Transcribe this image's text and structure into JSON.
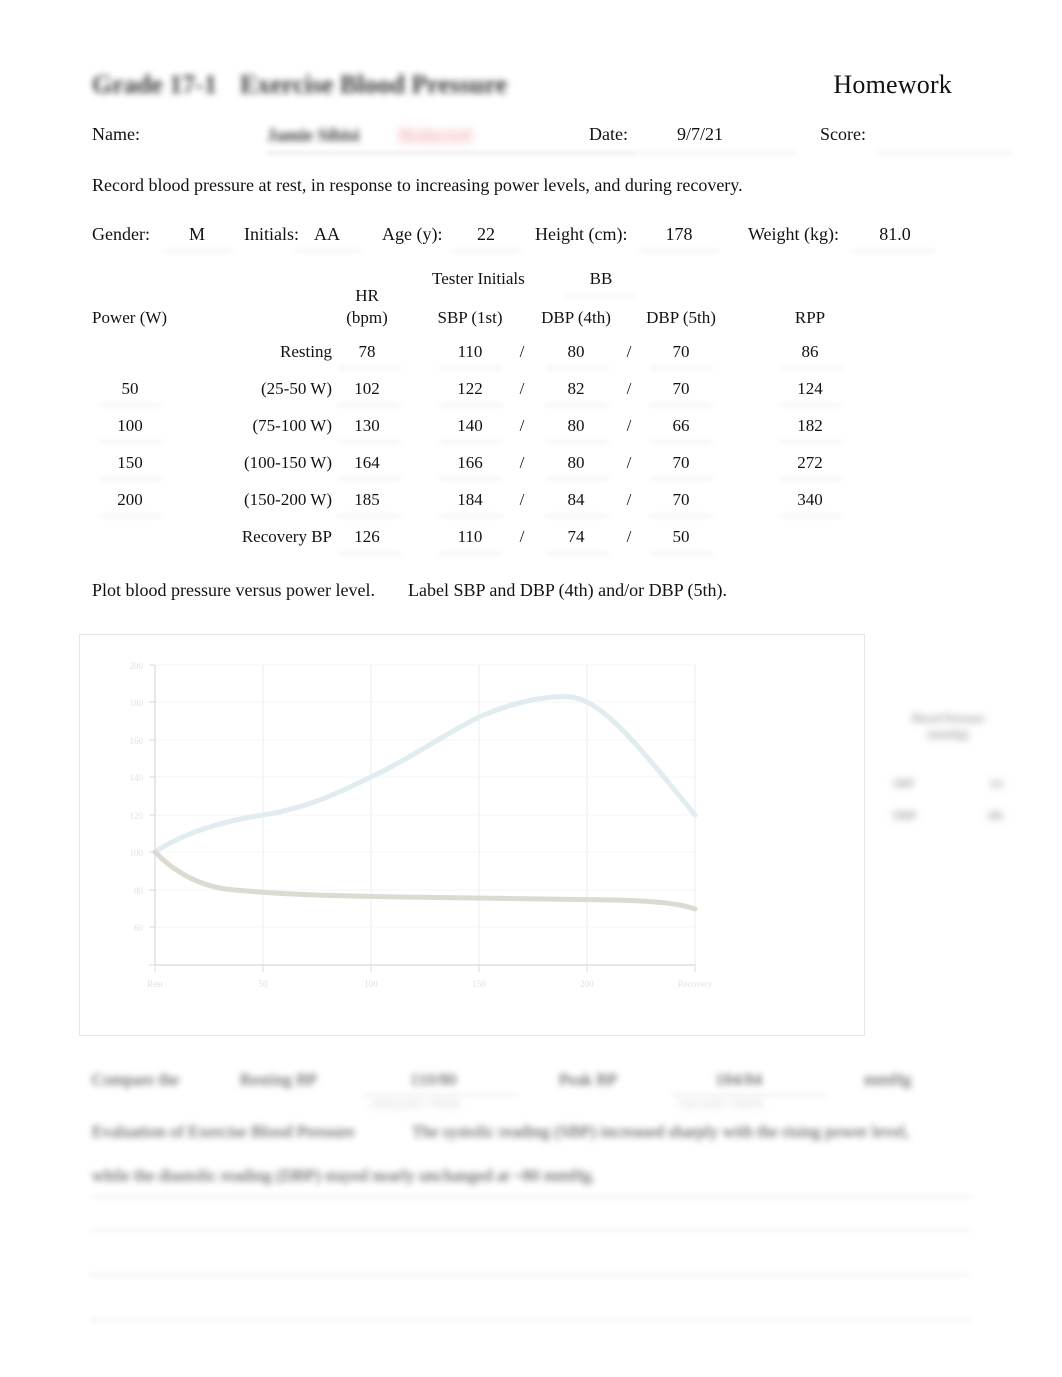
{
  "header": {
    "title_left": "Grade 17-1",
    "title_mid": "Exercise Blood Pressure",
    "title_right": "Homework",
    "name_label": "Name:",
    "name_value": "Jamie Sibisi",
    "name_value_2": "Redacted",
    "date_label": "Date:",
    "date_value": "9/7/21",
    "score_label": "Score:"
  },
  "instructions": {
    "record": "Record blood pressure at rest, in response to increasing power levels, and during recovery.",
    "plot": "Plot blood pressure versus power level.",
    "label": "Label SBP and DBP (4th) and/or DBP (5th)."
  },
  "subject": {
    "gender_label": "Gender:",
    "gender_value": "M",
    "initials_label": "Initials:",
    "initials_value": "AA",
    "age_label": "Age (y):",
    "age_value": "22",
    "height_label": "Height (cm):",
    "height_value": "178",
    "weight_label": "Weight (kg):",
    "weight_value": "81.0"
  },
  "table": {
    "tester_initials_label": "Tester Initials",
    "tester_initials_value": "BB",
    "headers": {
      "power": "Power (W)",
      "hr_top": "HR",
      "hr_units": "(bpm)",
      "sbp": "SBP (1st)",
      "dbp4": "DBP (4th)",
      "dbp5": "DBP (5th)",
      "rpp": "RPP",
      "slash": "/"
    },
    "rows": [
      {
        "power": "",
        "stage": "Resting",
        "hr": "78",
        "sbp": "110",
        "dbp4": "80",
        "dbp5": "70",
        "rpp": "86"
      },
      {
        "power": "50",
        "stage": "(25-50 W)",
        "hr": "102",
        "sbp": "122",
        "dbp4": "82",
        "dbp5": "70",
        "rpp": "124"
      },
      {
        "power": "100",
        "stage": "(75-100 W)",
        "hr": "130",
        "sbp": "140",
        "dbp4": "80",
        "dbp5": "66",
        "rpp": "182"
      },
      {
        "power": "150",
        "stage": "(100-150 W)",
        "hr": "164",
        "sbp": "166",
        "dbp4": "80",
        "dbp5": "70",
        "rpp": "272"
      },
      {
        "power": "200",
        "stage": "(150-200 W)",
        "hr": "185",
        "sbp": "184",
        "dbp4": "84",
        "dbp5": "70",
        "rpp": "340"
      },
      {
        "power": "",
        "stage": "Recovery BP",
        "hr": "126",
        "sbp": "110",
        "dbp4": "74",
        "dbp5": "50",
        "rpp": ""
      }
    ]
  },
  "chart_data": {
    "type": "line",
    "title": "",
    "xlabel": "",
    "ylabel": "",
    "categories": [
      "Resting",
      "50",
      "100",
      "150",
      "200",
      "Recovery"
    ],
    "x_tick_labels": [
      "Rest",
      "50",
      "100",
      "150",
      "200",
      "Recovery"
    ],
    "y_tick_labels": [
      "200",
      "180",
      "160",
      "140",
      "120",
      "100",
      "80",
      "60"
    ],
    "ylim": [
      50,
      210
    ],
    "grid": true,
    "legend_position": "right",
    "legend_title": "Blood Pressure",
    "series": [
      {
        "name": "SBP",
        "color": "#9dc3d4",
        "values": [
          110,
          122,
          140,
          166,
          184,
          110
        ]
      },
      {
        "name": "DBP (4th)",
        "color": "#8d8a6e",
        "values": [
          80,
          82,
          80,
          80,
          84,
          74
        ]
      }
    ]
  },
  "legend": {
    "title_line1": "Blood Pressure",
    "title_line2": "(mmHg)",
    "rows": [
      {
        "name": "SBP",
        "value": "1st"
      },
      {
        "name": "DBP",
        "value": "4th"
      }
    ]
  },
  "analysis": {
    "compare_label": "Compare the",
    "resting_label": "Resting BP",
    "resting_value": "110/80",
    "resting_underline_caption": "resting systolic / diastolic",
    "peak_label": "Peak BP",
    "peak_value": "184/84",
    "peak_underline_caption": "peak systolic / diastolic",
    "units_label": "mmHg",
    "conclusion_label": "Evaluation of Exercise Blood Pressure",
    "conclusion_text_line1": "The systolic reading (SBP) increased sharply with the rising power level,",
    "conclusion_text_line2": "while the diastolic reading (DBP) stayed nearly unchanged at ~80 mmHg."
  },
  "ruled_lines": [
    "",
    "",
    ""
  ]
}
